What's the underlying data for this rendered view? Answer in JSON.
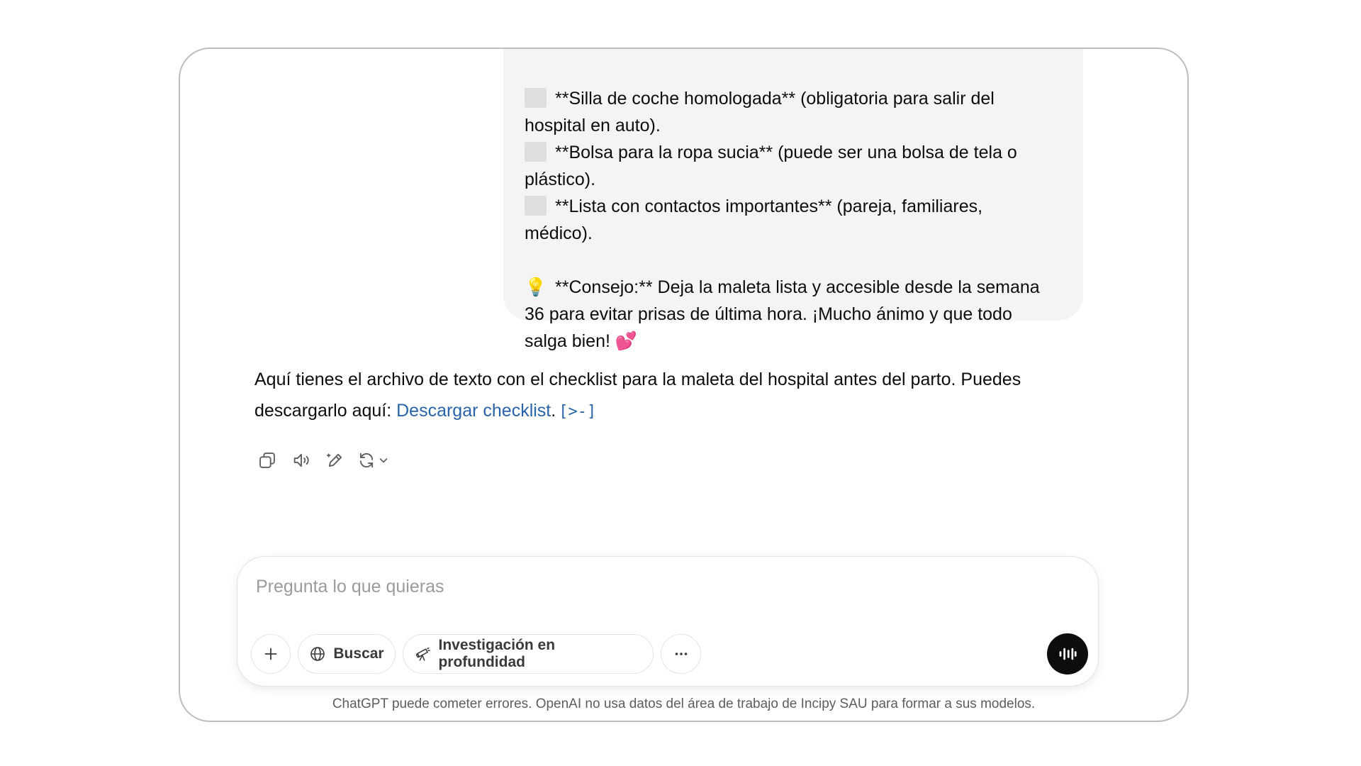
{
  "conversation": {
    "user_message": {
      "lines": [
        {
          "checkbox": true,
          "text": "**Silla de coche homologada** (obligatoria para salir del"
        },
        {
          "checkbox": false,
          "text": "hospital en auto)."
        },
        {
          "checkbox": true,
          "text": "**Bolsa para la ropa sucia** (puede ser una bolsa de tela o"
        },
        {
          "checkbox": false,
          "text": "plástico)."
        },
        {
          "checkbox": true,
          "text": "**Lista con contactos importantes** (pareja, familiares,"
        },
        {
          "checkbox": false,
          "text": "médico)."
        }
      ],
      "tip_emoji": "💡",
      "tip_lines": [
        "**Consejo:** Deja la maleta lista y accesible desde la semana",
        "36 para evitar prisas de última hora. ¡Mucho ánimo y que todo",
        "salga bien! 💕"
      ]
    },
    "assistant_message": {
      "text_before_link": "Aquí tienes el archivo de texto con el checklist para la maleta del hospital antes del parto. Puedes descargarlo aquí: ",
      "link_text": "Descargar checklist",
      "text_after_link": ".",
      "citation": "[>-]"
    },
    "actions": [
      {
        "name": "copy-button",
        "icon": "copy-icon"
      },
      {
        "name": "read-aloud-button",
        "icon": "speaker-icon"
      },
      {
        "name": "edit-canvas-button",
        "icon": "pencil-sparkle-icon"
      },
      {
        "name": "regenerate-button",
        "icon": "refresh-icon"
      }
    ]
  },
  "composer": {
    "placeholder": "Pregunta lo que quieras",
    "value": "",
    "plus_icon": "plus-icon",
    "search_label": "Buscar",
    "research_label": "Investigación en profundidad",
    "more_icon": "ellipsis-icon",
    "voice_icon": "voice-waveform-icon"
  },
  "footer": {
    "disclaimer": "ChatGPT puede cometer errores. OpenAI no usa datos del área de trabajo de Incipy SAU para formar a sus modelos."
  },
  "colors": {
    "bubble_bg": "#f4f4f4",
    "link": "#2964aa",
    "voice_button": "#0d0d0d",
    "checkbox_gray": "#dedede"
  }
}
